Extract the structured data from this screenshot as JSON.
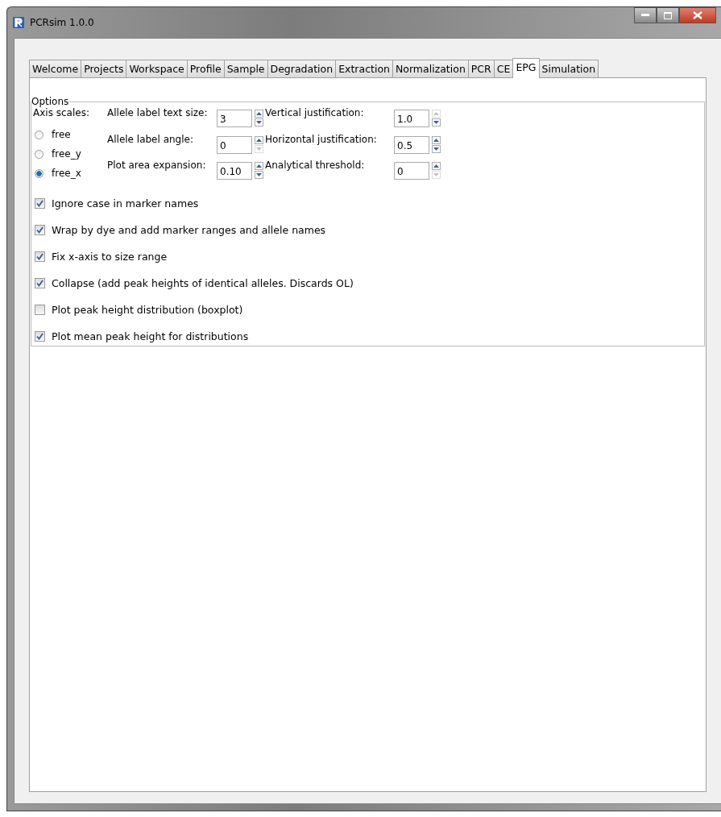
{
  "window": {
    "title": "PCRsim 1.0.0"
  },
  "tabs": [
    {
      "label": "Welcome",
      "selected": false
    },
    {
      "label": "Projects",
      "selected": false
    },
    {
      "label": "Workspace",
      "selected": false
    },
    {
      "label": "Profile",
      "selected": false
    },
    {
      "label": "Sample",
      "selected": false
    },
    {
      "label": "Degradation",
      "selected": false
    },
    {
      "label": "Extraction",
      "selected": false
    },
    {
      "label": "Normalization",
      "selected": false
    },
    {
      "label": "PCR",
      "selected": false
    },
    {
      "label": "CE",
      "selected": false
    },
    {
      "label": "EPG",
      "selected": true
    },
    {
      "label": "Simulation",
      "selected": false
    }
  ],
  "options": {
    "title": "Options",
    "axis_label": "Axis scales:",
    "axis_scales": [
      {
        "label": "free",
        "selected": false
      },
      {
        "label": "free_y",
        "selected": false
      },
      {
        "label": "free_x",
        "selected": true
      }
    ],
    "spinners": [
      {
        "label": "Allele label text size:",
        "value": "3",
        "up_disabled": false,
        "down_disabled": false
      },
      {
        "label": "Vertical justification:",
        "value": "1.0",
        "up_disabled": true,
        "down_disabled": false
      },
      {
        "label": "Allele label angle:",
        "value": "0",
        "up_disabled": false,
        "down_disabled": true
      },
      {
        "label": "Horizontal justification:",
        "value": "0.5",
        "up_disabled": false,
        "down_disabled": false
      },
      {
        "label": "Plot area expansion:",
        "value": "0.10",
        "up_disabled": false,
        "down_disabled": false
      },
      {
        "label": "Analytical threshold:",
        "value": "0",
        "up_disabled": false,
        "down_disabled": true
      }
    ],
    "checkboxes": [
      {
        "label": "Ignore case in marker names",
        "checked": true
      },
      {
        "label": "Wrap by dye and add marker ranges and allele names",
        "checked": true
      },
      {
        "label": "Fix x-axis to size range",
        "checked": true
      },
      {
        "label": "Collapse (add peak heights of identical alleles. Discards OL)",
        "checked": true
      },
      {
        "label": "Plot peak height distribution (boxplot)",
        "checked": false
      },
      {
        "label": "Plot mean peak height for distributions",
        "checked": true
      }
    ]
  }
}
